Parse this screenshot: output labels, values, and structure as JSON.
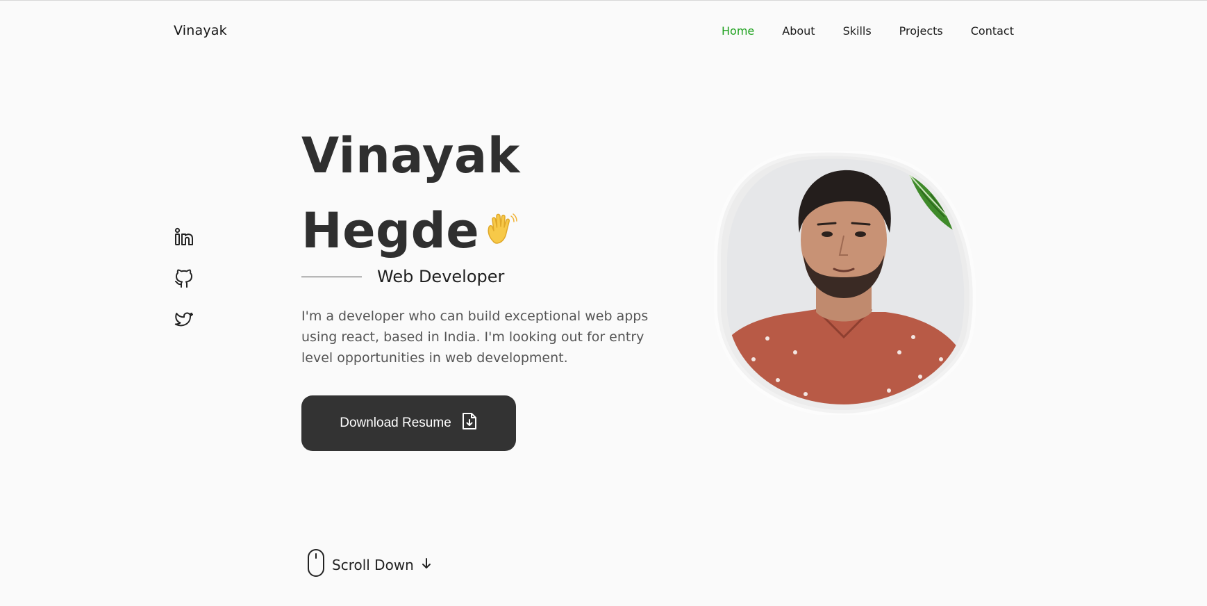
{
  "header": {
    "brand": "Vinayak",
    "nav": [
      {
        "label": "Home",
        "active": true
      },
      {
        "label": "About",
        "active": false
      },
      {
        "label": "Skills",
        "active": false
      },
      {
        "label": "Projects",
        "active": false
      },
      {
        "label": "Contact",
        "active": false
      }
    ]
  },
  "socials": [
    {
      "name": "linkedin",
      "icon": "linkedin-icon"
    },
    {
      "name": "github",
      "icon": "github-icon"
    },
    {
      "name": "twitter",
      "icon": "twitter-icon"
    }
  ],
  "hero": {
    "first_name": "Vinayak",
    "last_name": "Hegde",
    "wave_icon": "waving-hand-icon",
    "subtitle": "Web Developer",
    "description": "I'm a developer who can build exceptional web apps using react, based in India. I'm looking out for entry level opportunities in web development.",
    "resume_button": "Download Resume",
    "resume_icon": "file-download-icon",
    "scroll_label": "Scroll Down"
  },
  "colors": {
    "accent": "#1ea11e",
    "text_dark": "#2f2f2f",
    "button_bg": "#333333",
    "background": "#fafafa"
  }
}
